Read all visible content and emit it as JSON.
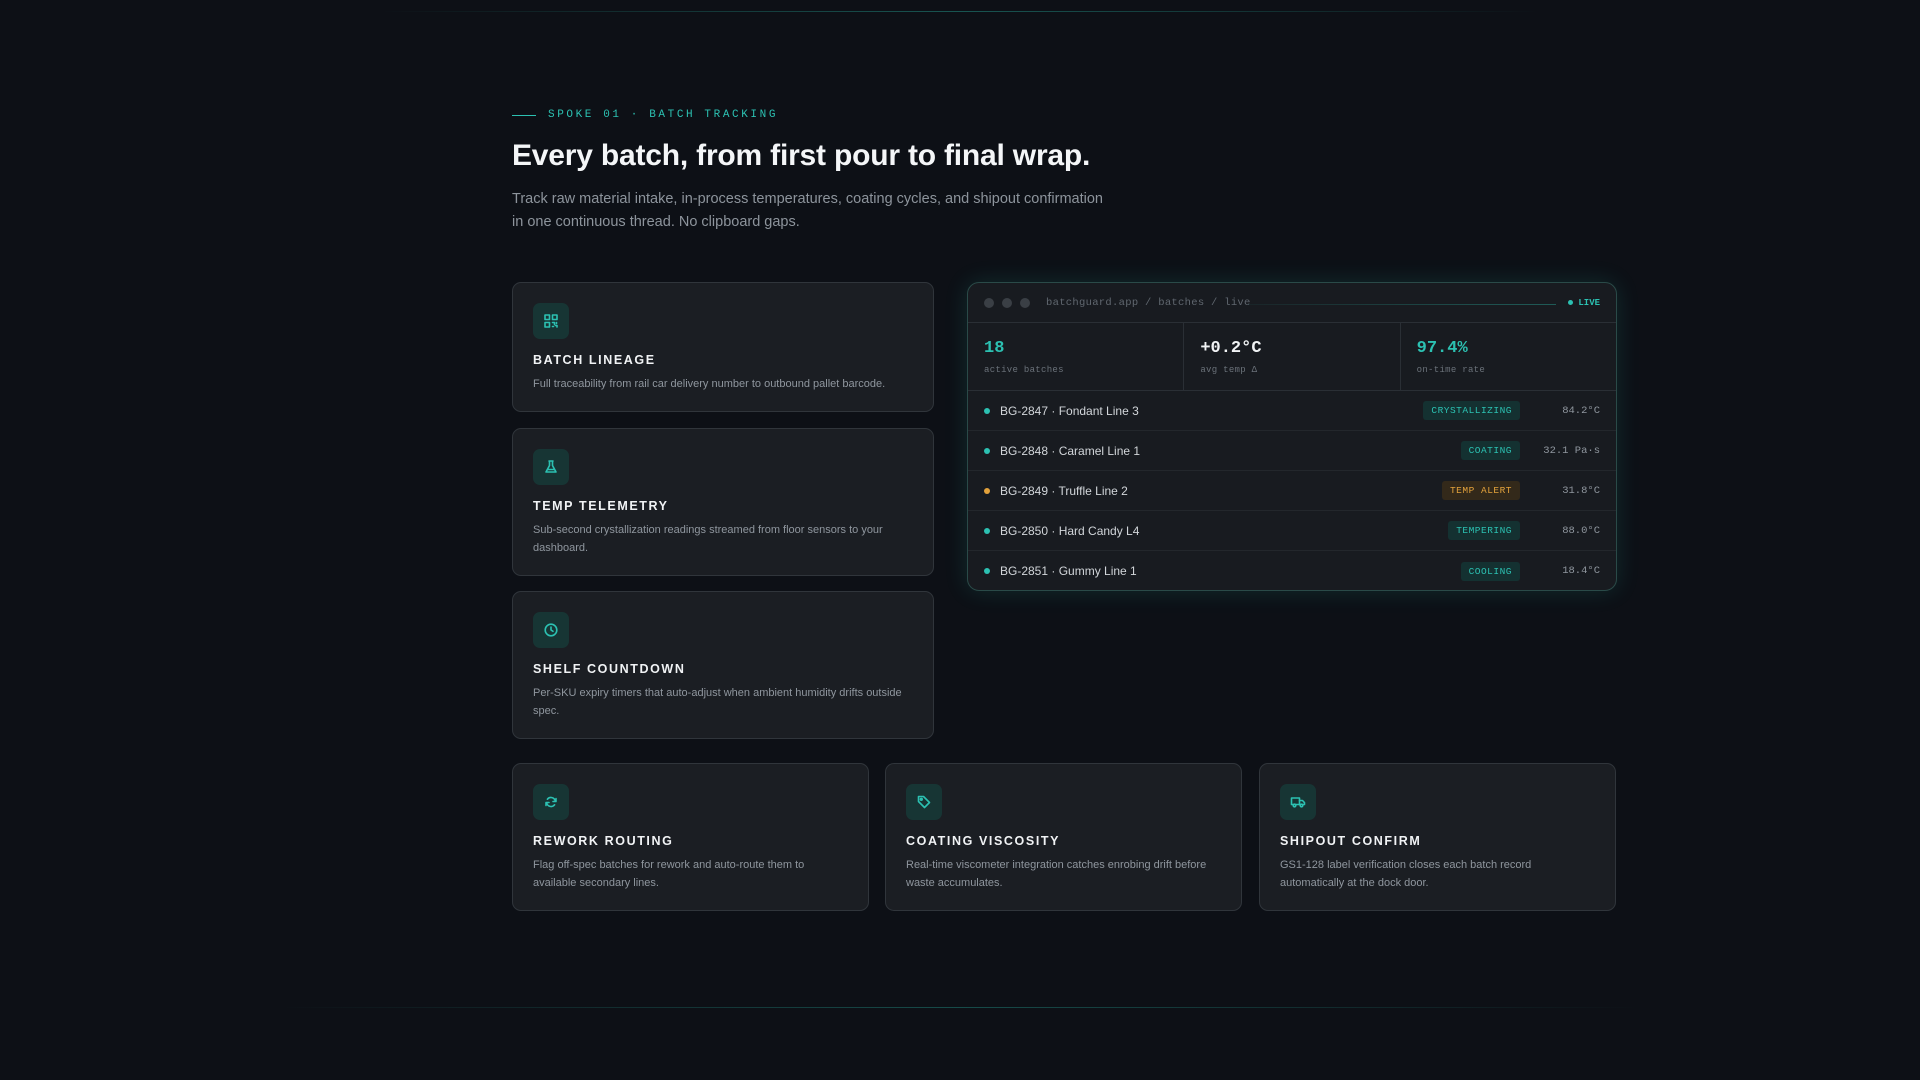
{
  "eyebrow": "SPOKE 01 · BATCH TRACKING",
  "title": "Every batch, from first pour to final wrap.",
  "subtitle": "Track raw material intake, in-process temperatures, coating cycles, and shipout confirmation in one continuous thread. No clipboard gaps.",
  "features": [
    {
      "title": "BATCH LINEAGE",
      "desc": "Full traceability from rail car delivery number to outbound pallet barcode.",
      "icon": "qr-code-icon"
    },
    {
      "title": "TEMP TELEMETRY",
      "desc": "Sub-second crystallization readings streamed from floor sensors to your dashboard.",
      "icon": "flask-icon"
    },
    {
      "title": "SHELF COUNTDOWN",
      "desc": "Per-SKU expiry timers that auto-adjust when ambient humidity drifts outside spec.",
      "icon": "clock-icon"
    },
    {
      "title": "REWORK ROUTING",
      "desc": "Flag off-spec batches for rework and auto-route them to available secondary lines.",
      "icon": "refresh-icon"
    },
    {
      "title": "COATING VISCOSITY",
      "desc": "Real-time viscometer integration catches enrobing drift before waste accumulates.",
      "icon": "tag-icon"
    },
    {
      "title": "SHIPOUT CONFIRM",
      "desc": "GS1-128 label verification closes each batch record automatically at the dock door.",
      "icon": "truck-icon"
    }
  ],
  "panel": {
    "url": "batchguard.app / batches / live",
    "live": "LIVE",
    "stats": [
      {
        "value": "18",
        "label": "active batches",
        "color": "#2cc1b2"
      },
      {
        "value": "+0.2°C",
        "label": "avg temp Δ",
        "color": "#f1f3f5"
      },
      {
        "value": "97.4%",
        "label": "on-time rate",
        "color": "#2cc1b2"
      }
    ],
    "rows": [
      {
        "name": "BG-2847 · Fondant Line 3",
        "status": "CRYSTALLIZING",
        "value": "84.2°C",
        "tone": "teal"
      },
      {
        "name": "BG-2848 · Caramel Line 1",
        "status": "COATING",
        "value": "32.1 Pa·s",
        "tone": "teal"
      },
      {
        "name": "BG-2849 · Truffle Line 2",
        "status": "TEMP ALERT",
        "value": "31.8°C",
        "tone": "amber"
      },
      {
        "name": "BG-2850 · Hard Candy L4",
        "status": "TEMPERING",
        "value": "88.0°C",
        "tone": "teal"
      },
      {
        "name": "BG-2851 · Gummy Line 1",
        "status": "COOLING",
        "value": "18.4°C",
        "tone": "teal"
      }
    ]
  },
  "colors": {
    "accent": "#2cc1b2",
    "alert": "#e2a13b"
  }
}
